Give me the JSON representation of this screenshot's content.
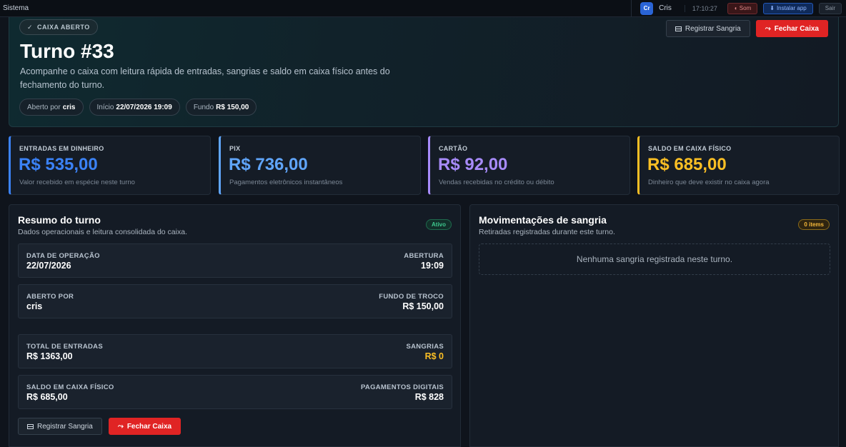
{
  "topbar": {
    "system_label": "Sistema",
    "avatar_initials": "Cr",
    "user_name": "Cris",
    "clock": "17:10:27",
    "sound_label": "Som",
    "install_label": "Instalar app",
    "exit_label": "Sair"
  },
  "hero": {
    "status_badge": "CAIXA ABERTO",
    "title": "Turno #33",
    "description": "Acompanhe o caixa com leitura rápida de entradas, sangrias e saldo em caixa físico antes do fechamento do turno.",
    "pills": {
      "opened_by_label": "Aberto por",
      "opened_by_value": "cris",
      "start_label": "Início",
      "start_value": "22/07/2026 19:09",
      "fund_label": "Fundo",
      "fund_value": "R$ 150,00"
    },
    "register_button": "Registrar Sangria",
    "close_button": "Fechar Caixa"
  },
  "stats": [
    {
      "label": "ENTRADAS EM DINHEIRO",
      "value": "R$ 535,00",
      "sub": "Valor recebido em espécie neste turno",
      "color": "#3b82f6"
    },
    {
      "label": "PIX",
      "value": "R$ 736,00",
      "sub": "Pagamentos eletrônicos instantâneos",
      "color": "#60a5fa"
    },
    {
      "label": "CARTÃO",
      "value": "R$ 92,00",
      "sub": "Vendas recebidas no crédito ou débito",
      "color": "#a78bfa"
    },
    {
      "label": "SALDO EM CAIXA FÍSICO",
      "value": "R$ 685,00",
      "sub": "Dinheiro que deve existir no caixa agora",
      "color": "#fbbf24"
    }
  ],
  "summary": {
    "title": "Resumo do turno",
    "subtitle": "Dados operacionais e leitura consolidada do caixa.",
    "status": "Ativo",
    "rows": [
      {
        "lk": "DATA DE OPERAÇÃO",
        "lv": "22/07/2026",
        "rk": "ABERTURA",
        "rv": "19:09"
      },
      {
        "lk": "ABERTO POR",
        "lv": "cris",
        "rk": "FUNDO DE TROCO",
        "rv": "R$ 150,00"
      },
      {
        "lk": "TOTAL DE ENTRADAS",
        "lv": "R$ 1363,00",
        "rk": "SANGRIAS",
        "rv": "R$ 0"
      },
      {
        "lk": "SALDO EM CAIXA FÍSICO",
        "lv": "R$ 685,00",
        "rk": "PAGAMENTOS DIGITAIS",
        "rv": "R$ 828"
      }
    ],
    "register_button": "Registrar Sangria",
    "close_button": "Fechar Caixa"
  },
  "withdrawals": {
    "title": "Movimentações de sangria",
    "subtitle": "Retiradas registradas durante este turno.",
    "count_badge": "0 items",
    "empty_message": "Nenhuma sangria registrada neste turno."
  },
  "colors": {
    "accent_red": "#e02424",
    "sangria_amber": "#fbbf24",
    "active_green": "#3ec98e"
  }
}
